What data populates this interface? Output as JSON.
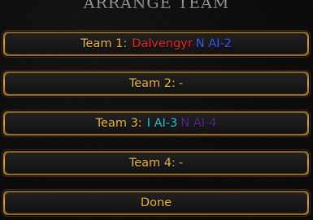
{
  "title": "ARRANGE TEAM",
  "teams": [
    {
      "label": "Team 1:",
      "players": [
        {
          "name": "Dalvengyr",
          "color": "#e02a22"
        },
        {
          "name": "N AI-2",
          "color": "#3a5cf0"
        }
      ]
    },
    {
      "label": "Team 2:",
      "empty": "-"
    },
    {
      "label": "Team 3:",
      "players": [
        {
          "name": "I AI-3",
          "color": "#22c8d8"
        },
        {
          "name": "N AI-4",
          "color": "#5a2a8a"
        }
      ]
    },
    {
      "label": "Team 4:",
      "empty": "-"
    }
  ],
  "done_label": "Done",
  "colors": {
    "label_gold": "#eeb92b",
    "frame_gold": "#d3a84a",
    "background": "#0b0b0c"
  }
}
